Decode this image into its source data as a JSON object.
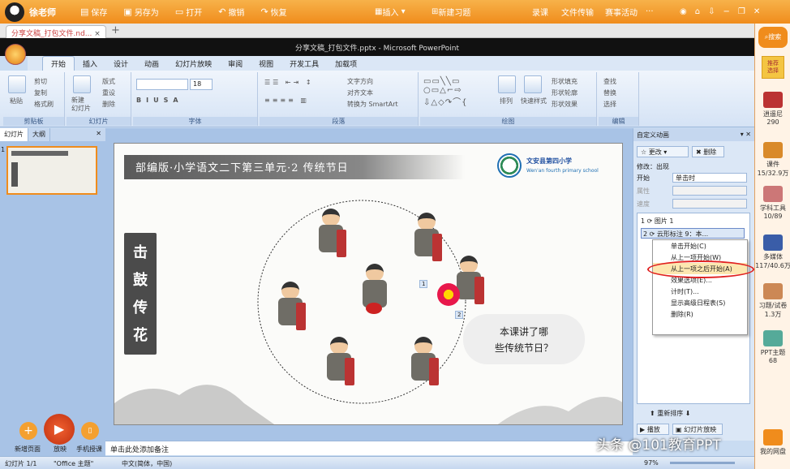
{
  "topbar": {
    "user": "徐老师",
    "buttons": [
      "保存",
      "另存为",
      "打开",
      "撤销",
      "恢复"
    ],
    "insert": "插入",
    "new_exercise": "新建习题",
    "links": [
      "录课",
      "文件传输",
      "赛事活动",
      "···"
    ],
    "search": "搜索"
  },
  "doc_tab": "分享文稿_打包文件.nd...",
  "window_title": "分享文稿_打包文件.pptx - Microsoft PowerPoint",
  "ribbon_tabs": [
    "开始",
    "插入",
    "设计",
    "动画",
    "幻灯片放映",
    "审阅",
    "视图",
    "开发工具",
    "加载项"
  ],
  "ribbon_groups": [
    "剪贴板",
    "幻灯片",
    "字体",
    "段落",
    "绘图",
    "编辑"
  ],
  "ribbon": {
    "paste": "粘贴",
    "cut": "剪切",
    "copy": "复制",
    "format_painter": "格式刷",
    "new_slide": "新建\n幻灯片",
    "layout": "版式",
    "reset": "重设",
    "delete": "删除",
    "font_size": "18",
    "text_direction": "文字方向",
    "align_text": "对齐文本",
    "smartart": "转换为 SmartArt",
    "arrange": "排列",
    "quick_styles": "快速样式",
    "shape_fill": "形状填充",
    "shape_outline": "形状轮廓",
    "shape_effects": "形状效果",
    "find": "查找",
    "replace": "替换",
    "select": "选择"
  },
  "left_pane": {
    "tabs": [
      "幻灯片",
      "大纲"
    ],
    "slide_number": "1"
  },
  "slide": {
    "banner": "部编版·小学语文二下第三单元·2 传统节日",
    "school_cn": "文安县第四小学",
    "school_en": "Wen'an fourth primary school",
    "vertical_title": [
      "击",
      "鼓",
      "传",
      "花"
    ],
    "bubble_lines": [
      "本课讲了哪",
      "些传统节日？"
    ],
    "markers": [
      "1",
      "2"
    ]
  },
  "anim_pane": {
    "title": "自定义动画",
    "change": "更改",
    "delete": "删除",
    "modify": "修改：出现",
    "start_label": "开始",
    "start_value": "单击时",
    "property_label": "属性",
    "speed_label": "速度",
    "items": [
      "1 ⟳ 图片 1",
      "2 ⟳ 云形标注 9：本..."
    ],
    "menu": [
      "单击开始(C)",
      "从上一项开始(W)",
      "从上一项之后开始(A)",
      "效果选项(E)...",
      "计时(T)...",
      "显示高级日程表(S)",
      "删除(R)"
    ],
    "reorder": "重新排序",
    "play": "播放",
    "slideshow": "幻灯片放映"
  },
  "sidebar": [
    {
      "label": "逍遥尼",
      "count": "290"
    },
    {
      "label": "课件",
      "count": "15/32.9万"
    },
    {
      "label": "学科工具",
      "count": "10/89"
    },
    {
      "label": "多媒体",
      "count": "117/40.6万"
    },
    {
      "label": "习题/试卷",
      "count": "1.3万"
    },
    {
      "label": "PPT主题",
      "count": "68"
    },
    {
      "label": "我的网盘",
      "count": ""
    }
  ],
  "sidebar_top": "推荐\n选择",
  "bottom_left": [
    "新增页面",
    "放映",
    "手机授课"
  ],
  "notes": "单击此处添加备注",
  "status": {
    "slide": "幻灯片 1/1",
    "theme": "\"Office 主题\"",
    "lang": "中文(简体，中国)",
    "zoom": "97%"
  },
  "watermark": "头条 @101教育PPT"
}
